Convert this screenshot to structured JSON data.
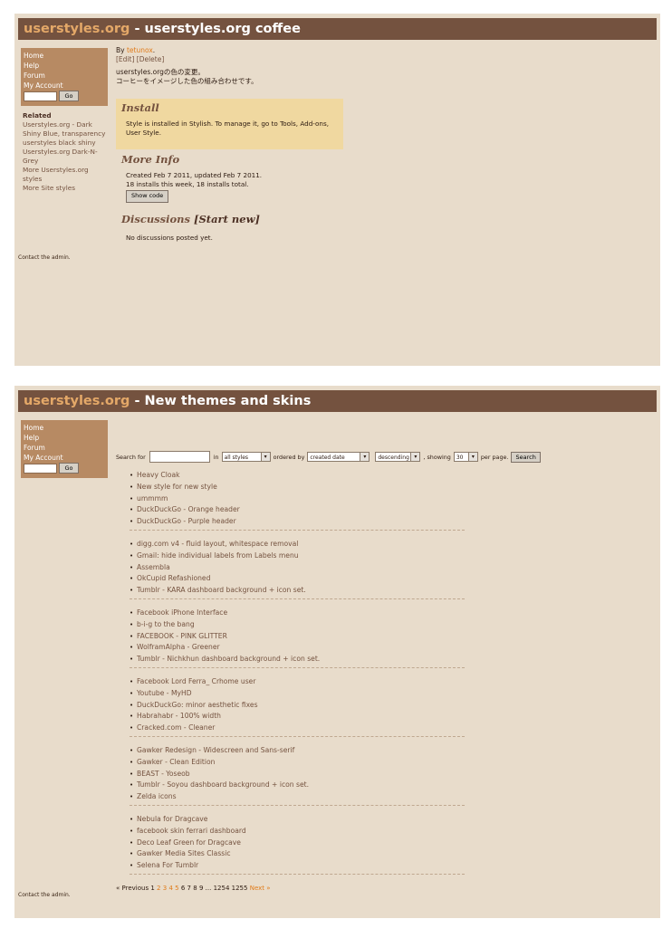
{
  "panel1": {
    "title_site": "userstyles.org",
    "title_rest": " - userstyles.org coffee",
    "nav": [
      "Home",
      "Help",
      "Forum",
      "My Account"
    ],
    "go_label": "Go",
    "related_heading": "Related",
    "related": [
      "Userstyles.org - Dark Shiny Blue, transparency",
      "userstyles black shiny",
      "Userstyles.org Dark-N-Grey",
      "More Userstyles.org styles",
      "More Site styles"
    ],
    "by_label": "By ",
    "author": "tetunox",
    "by_suffix": ".",
    "edit": "[Edit]",
    "delete": "[Delete]",
    "desc_line1": "userstyles.orgの色の変更。",
    "desc_line2": "コーヒーをイメージした色の組み合わせです。",
    "install_heading": "Install",
    "install_text": "Style is installed in Stylish. To manage it, go to Tools, Add-ons, User Style.",
    "more_info_heading": "More Info",
    "created": "Created Feb 7 2011, updated Feb 7 2011.",
    "installs": "18 installs this week, 18 installs total.",
    "show_code": "Show code",
    "discussions_heading": "Discussions ",
    "start_new": "[Start new]",
    "no_discussions": "No discussions posted yet.",
    "contact": "Contact the admin."
  },
  "panel2": {
    "title_site": "userstyles.org",
    "title_rest": " - New themes and skins",
    "nav": [
      "Home",
      "Help",
      "Forum",
      "My Account"
    ],
    "go_label": "Go",
    "search_for": "Search for",
    "in_label": "in",
    "in_value": "all styles",
    "ordered_by": "ordered by",
    "order_value": "created date",
    "direction_value": "descending",
    "showing_label": ", showing",
    "showing_value": "30",
    "per_page": "per page.",
    "search_button": "Search",
    "groups": [
      [
        "Heavy Cloak",
        "New style for new style",
        "ummmm",
        "DuckDuckGo - Orange header",
        "DuckDuckGo - Purple header"
      ],
      [
        "digg.com v4 - fluid layout, whitespace removal",
        "Gmail: hide individual labels from Labels menu",
        "Assembla",
        "OkCupid Refashioned",
        "Tumblr - KARA dashboard background + icon set."
      ],
      [
        "Facebook iPhone Interface",
        "b-i-g to the bang",
        "FACEBOOK - PINK GLITTER",
        "WolframAlpha - Greener",
        "Tumblr - Nichkhun dashboard background + icon set."
      ],
      [
        "Facebook Lord Ferra_ Crhome user",
        "Youtube - MyHD",
        "DuckDuckGo: minor aesthetic fixes",
        "Habrahabr - 100% width",
        "Cracked.com - Cleaner"
      ],
      [
        "Gawker Redesign - Widescreen and Sans-serif",
        "Gawker - Clean Edition",
        "BEAST - Yoseob",
        "Tumblr - Soyou dashboard background + icon set.",
        "Zelda icons"
      ],
      [
        "Nebula for Dragcave",
        "facebook skin ferrari dashboard",
        "Deco Leaf Green for Dragcave",
        "Gawker Media Sites Classic",
        "Selena For Tumblr"
      ]
    ],
    "pager": {
      "prev": "« Previous",
      "current": "1",
      "linked": [
        "2",
        "3",
        "4",
        "5"
      ],
      "plain": [
        "6",
        "7",
        "8",
        "9",
        "...",
        "1254",
        "1255"
      ],
      "next": "Next »"
    },
    "contact": "Contact the admin."
  }
}
